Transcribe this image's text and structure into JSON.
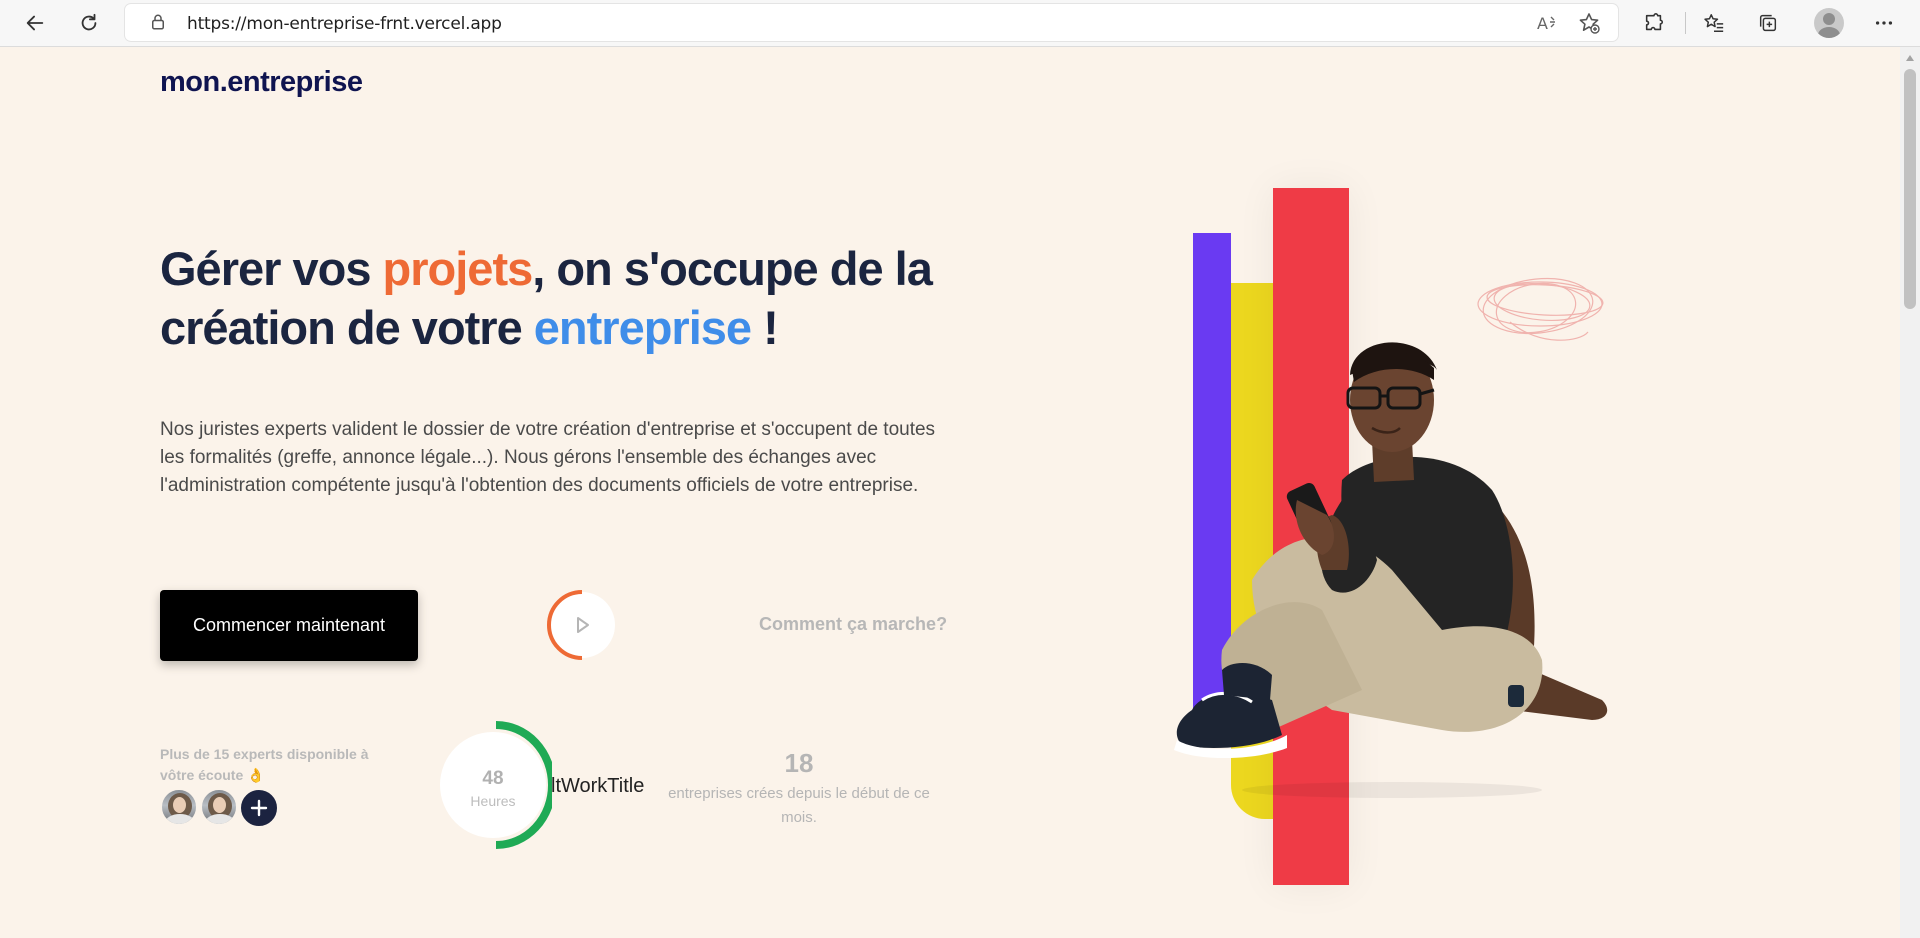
{
  "browser": {
    "url": "https://mon-entreprise-frnt.vercel.app"
  },
  "page": {
    "logo": "mon.entreprise",
    "headline": {
      "part1": "Gérer vos ",
      "highlight1": "projets",
      "part2": ", on s'occupe de la création de votre ",
      "highlight2": "entreprise",
      "part3": " !"
    },
    "description": "Nos juristes experts valident le dossier de votre création d'entreprise et s'occupent de toutes les formalités (greffe, annonce légale...). Nous gérons l'ensemble des échanges avec l'administration compétente jusqu'à l'obtention des documents officiels de votre entreprise.",
    "cta_label": "Commencer maintenant",
    "how_it_works": "Comment ça marche?",
    "experts_text": "Plus de 15 experts disponible à vôtre écoute 👌",
    "stat": {
      "number": "48",
      "unit": "Heures",
      "title": "ltWorkTitle"
    },
    "count": {
      "number": "18",
      "label": "entreprises crées depuis le début de ce mois."
    }
  },
  "colors": {
    "background": "#fbf3ea",
    "headline": "#1b2540",
    "highlight_orange": "#ee6a35",
    "highlight_blue": "#3f8de9",
    "bar_purple": "#6a3af2",
    "bar_yellow": "#ecd71f",
    "bar_red": "#ef3b46",
    "progress_green": "#1faa55"
  }
}
